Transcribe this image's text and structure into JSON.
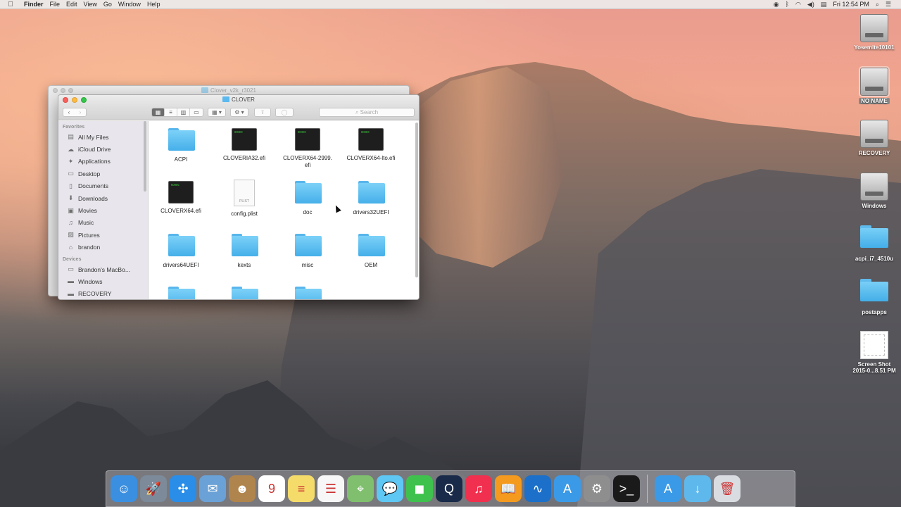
{
  "menubar": {
    "app": "Finder",
    "items": [
      "File",
      "Edit",
      "View",
      "Go",
      "Window",
      "Help"
    ],
    "clock": "Fri 12:54 PM"
  },
  "desktop": {
    "icons": [
      {
        "label": "Yosemite10101",
        "kind": "drive"
      },
      {
        "label": "NO NAME",
        "kind": "drive"
      },
      {
        "label": "RECOVERY",
        "kind": "drive"
      },
      {
        "label": "Windows",
        "kind": "drive"
      },
      {
        "label": "acpi_i7_4510u",
        "kind": "folder"
      },
      {
        "label": "postapps",
        "kind": "folder"
      },
      {
        "label": "Screen Shot",
        "label2": "2015-0...8.51 PM",
        "kind": "screenshot"
      }
    ]
  },
  "back_window": {
    "title": "Clover_v2k_r3021"
  },
  "finder": {
    "title": "CLOVER",
    "search_placeholder": "Search",
    "sidebar": {
      "favorites_header": "Favorites",
      "favorites": [
        {
          "label": "All My Files",
          "icon": "all-files-icon"
        },
        {
          "label": "iCloud Drive",
          "icon": "cloud-icon"
        },
        {
          "label": "Applications",
          "icon": "applications-icon"
        },
        {
          "label": "Desktop",
          "icon": "desktop-icon"
        },
        {
          "label": "Documents",
          "icon": "documents-icon"
        },
        {
          "label": "Downloads",
          "icon": "downloads-icon"
        },
        {
          "label": "Movies",
          "icon": "movies-icon"
        },
        {
          "label": "Music",
          "icon": "music-icon"
        },
        {
          "label": "Pictures",
          "icon": "pictures-icon"
        },
        {
          "label": "brandon",
          "icon": "home-icon"
        }
      ],
      "devices_header": "Devices",
      "devices": [
        {
          "label": "Brandon's MacBo...",
          "icon": "laptop-icon"
        },
        {
          "label": "Windows",
          "icon": "drive-icon"
        },
        {
          "label": "RECOVERY",
          "icon": "drive-icon"
        }
      ]
    },
    "files": [
      {
        "name": "ACPI",
        "kind": "folder"
      },
      {
        "name": "CLOVERIA32.efi",
        "kind": "exec"
      },
      {
        "name": "CLOVERX64-2999.",
        "name2": "efi",
        "kind": "exec"
      },
      {
        "name": "CLOVERX64-lto.efi",
        "kind": "exec"
      },
      {
        "name": "CLOVERX64.efi",
        "kind": "exec"
      },
      {
        "name": "config.plist",
        "kind": "plist"
      },
      {
        "name": "doc",
        "kind": "folder"
      },
      {
        "name": "drivers32UEFI",
        "kind": "folder"
      },
      {
        "name": "drivers64UEFI",
        "kind": "folder"
      },
      {
        "name": "kexts",
        "kind": "folder"
      },
      {
        "name": "misc",
        "kind": "folder"
      },
      {
        "name": "OEM",
        "kind": "folder"
      },
      {
        "name": "",
        "kind": "folder"
      },
      {
        "name": "",
        "kind": "folder"
      },
      {
        "name": "",
        "kind": "folder"
      }
    ]
  },
  "dock": {
    "apps": [
      {
        "name": "finder",
        "color": "#3b8fe0",
        "glyph": "☺"
      },
      {
        "name": "launchpad",
        "color": "#7c8a99",
        "glyph": "🚀"
      },
      {
        "name": "safari",
        "color": "#2a8de8",
        "glyph": "✣"
      },
      {
        "name": "mail",
        "color": "#6aa1d6",
        "glyph": "✉"
      },
      {
        "name": "contacts",
        "color": "#b0844d",
        "glyph": "☻"
      },
      {
        "name": "calendar",
        "color": "#ffffff",
        "glyph": "9"
      },
      {
        "name": "notes",
        "color": "#f5dc6a",
        "glyph": "≡"
      },
      {
        "name": "reminders",
        "color": "#f7f7f7",
        "glyph": "☰"
      },
      {
        "name": "maps",
        "color": "#7fbf6d",
        "glyph": "⌖"
      },
      {
        "name": "messages",
        "color": "#5ec7f4",
        "glyph": "💬"
      },
      {
        "name": "facetime",
        "color": "#3ec24d",
        "glyph": "◼"
      },
      {
        "name": "quicktime",
        "color": "#1a2b4a",
        "glyph": "Q"
      },
      {
        "name": "itunes",
        "color": "#f0304e",
        "glyph": "♫"
      },
      {
        "name": "ibooks",
        "color": "#f39a1f",
        "glyph": "📖"
      },
      {
        "name": "intel-power-gadget",
        "color": "#1c70c9",
        "glyph": "∿"
      },
      {
        "name": "app-store",
        "color": "#3a9ae8",
        "glyph": "A"
      },
      {
        "name": "system-preferences",
        "color": "#8e8e8e",
        "glyph": "⚙"
      },
      {
        "name": "terminal",
        "color": "#1a1a1a",
        "glyph": ">_"
      }
    ],
    "right": [
      {
        "name": "app-store-downloads",
        "color": "#3a9ae8",
        "glyph": "A"
      },
      {
        "name": "downloads-stack",
        "color": "#5fb8ec",
        "glyph": "↓"
      },
      {
        "name": "trash",
        "color": "#d9dde2",
        "glyph": "🗑"
      }
    ]
  }
}
